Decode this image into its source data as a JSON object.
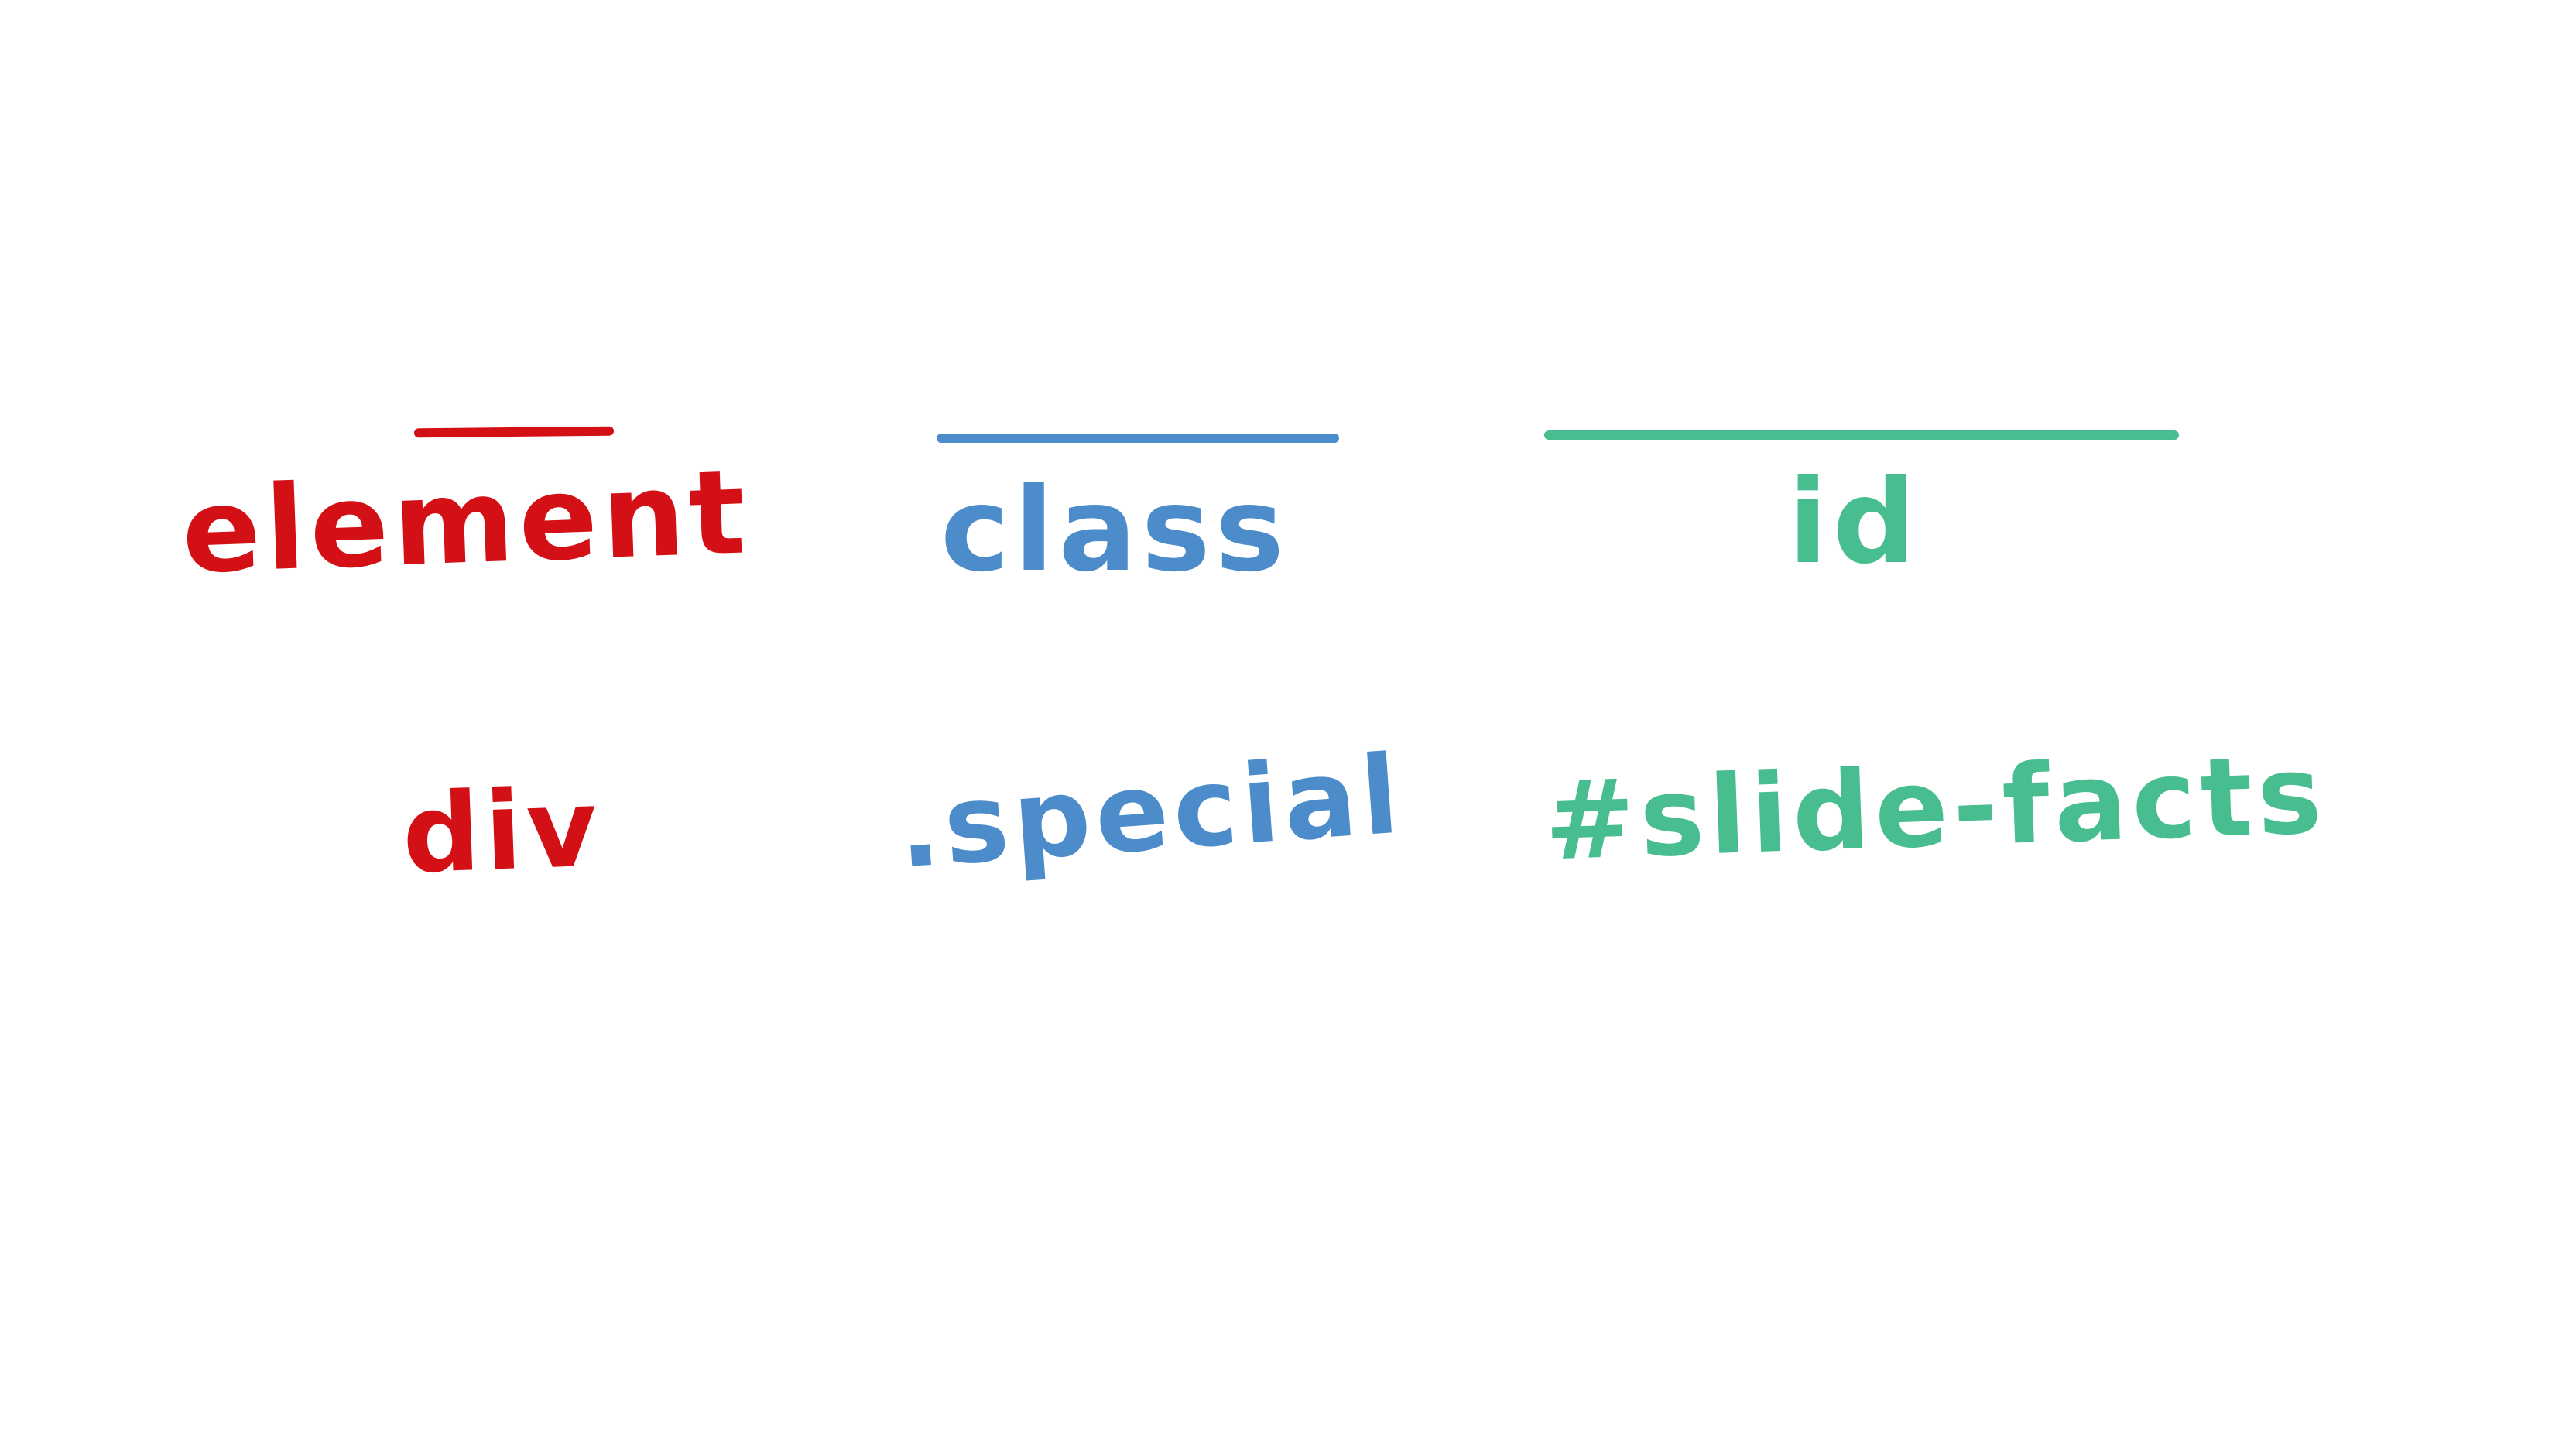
{
  "colors": {
    "element": "#d31015",
    "class": "#4d8cca",
    "id": "#48bd8f",
    "background": "#ffffff"
  },
  "columns": [
    {
      "heading": "element",
      "example": "div"
    },
    {
      "heading": "class",
      "example": ".special"
    },
    {
      "heading": "id",
      "example": "#slide-facts"
    }
  ]
}
